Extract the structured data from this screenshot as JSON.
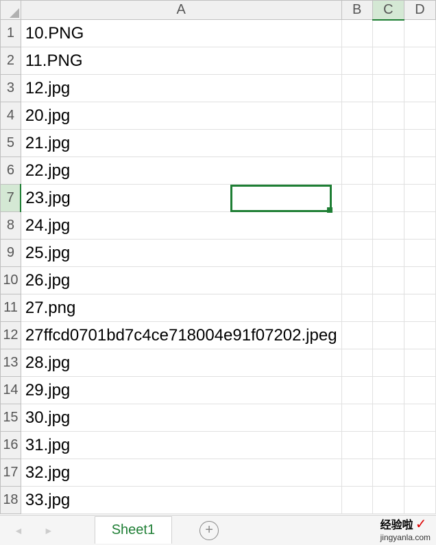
{
  "columns": [
    "A",
    "B",
    "C",
    "D"
  ],
  "activeColumn": "C",
  "activeRow": 7,
  "selectedCell": "C7",
  "rows": [
    {
      "num": 1,
      "A": "10.PNG"
    },
    {
      "num": 2,
      "A": "11.PNG"
    },
    {
      "num": 3,
      "A": "12.jpg"
    },
    {
      "num": 4,
      "A": "20.jpg"
    },
    {
      "num": 5,
      "A": "21.jpg"
    },
    {
      "num": 6,
      "A": "22.jpg"
    },
    {
      "num": 7,
      "A": "23.jpg"
    },
    {
      "num": 8,
      "A": "24.jpg"
    },
    {
      "num": 9,
      "A": "25.jpg"
    },
    {
      "num": 10,
      "A": "26.jpg"
    },
    {
      "num": 11,
      "A": "27.png"
    },
    {
      "num": 12,
      "A": "27ffcd0701bd7c4ce718004e91f07202.jpeg"
    },
    {
      "num": 13,
      "A": "28.jpg"
    },
    {
      "num": 14,
      "A": "29.jpg"
    },
    {
      "num": 15,
      "A": "30.jpg"
    },
    {
      "num": 16,
      "A": "31.jpg"
    },
    {
      "num": 17,
      "A": "32.jpg"
    },
    {
      "num": 18,
      "A": "33.jpg"
    }
  ],
  "sheetTab": "Sheet1",
  "watermark": {
    "brand": "经验啦",
    "url": "jingyanla.com"
  }
}
